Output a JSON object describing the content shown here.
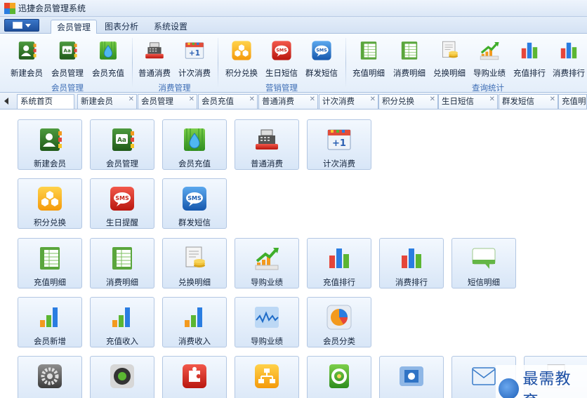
{
  "window": {
    "title": "迅捷会员管理系统"
  },
  "ribbon_tabs": [
    {
      "label": "会员管理",
      "active": true
    },
    {
      "label": "图表分析",
      "active": false
    },
    {
      "label": "系统设置",
      "active": false
    }
  ],
  "ribbon": {
    "buttons": [
      {
        "label": "新建会员",
        "icon": "member-card-icon"
      },
      {
        "label": "会员管理",
        "icon": "member-book-icon"
      },
      {
        "label": "会员充值",
        "icon": "water-drop-icon"
      },
      {
        "label": "普通消费",
        "icon": "cash-register-icon"
      },
      {
        "label": "计次消费",
        "icon": "plus-one-calendar-icon"
      },
      {
        "label": "积分兑换",
        "icon": "honeycomb-icon"
      },
      {
        "label": "生日短信",
        "icon": "sms-red-icon"
      },
      {
        "label": "群发短信",
        "icon": "sms-blue-icon"
      },
      {
        "label": "充值明细",
        "icon": "green-sheet-icon"
      },
      {
        "label": "消费明细",
        "icon": "green-sheet-icon"
      },
      {
        "label": "兑换明细",
        "icon": "coin-document-icon"
      },
      {
        "label": "导购业绩",
        "icon": "growth-arrow-chart-icon"
      },
      {
        "label": "充值排行",
        "icon": "bar-chart-icon"
      },
      {
        "label": "消费排行",
        "icon": "bar-chart-icon"
      }
    ],
    "groups": [
      {
        "label": "会员管理"
      },
      {
        "label": "消费管理"
      },
      {
        "label": "营销管理"
      },
      {
        "label": "查询统计"
      }
    ]
  },
  "doc_tabs": [
    {
      "label": "系统首页",
      "active": true,
      "closable": false
    },
    {
      "label": "新建会员",
      "closable": true
    },
    {
      "label": "会员管理",
      "closable": true
    },
    {
      "label": "会员充值",
      "closable": true
    },
    {
      "label": "普通消费",
      "closable": true
    },
    {
      "label": "计次消费",
      "closable": true
    },
    {
      "label": "积分兑换",
      "closable": true
    },
    {
      "label": "生日短信",
      "closable": true
    },
    {
      "label": "群发短信",
      "closable": true
    },
    {
      "label": "充值明",
      "closable": false
    }
  ],
  "home_tiles": {
    "row1": [
      {
        "label": "新建会员",
        "icon": "member-card-icon"
      },
      {
        "label": "会员管理",
        "icon": "member-book-icon"
      },
      {
        "label": "会员充值",
        "icon": "water-drop-icon"
      },
      {
        "label": "普通消费",
        "icon": "cash-register-icon"
      },
      {
        "label": "计次消费",
        "icon": "plus-one-calendar-icon"
      }
    ],
    "row2": [
      {
        "label": "积分兑换",
        "icon": "honeycomb-icon"
      },
      {
        "label": "生日提醒",
        "icon": "sms-red-icon"
      },
      {
        "label": "群发短信",
        "icon": "sms-blue-icon"
      }
    ],
    "row3": [
      {
        "label": "充值明细",
        "icon": "green-sheet-icon"
      },
      {
        "label": "消费明细",
        "icon": "green-sheet-icon"
      },
      {
        "label": "兑换明细",
        "icon": "coin-document-icon"
      },
      {
        "label": "导购业绩",
        "icon": "growth-arrow-chart-icon"
      },
      {
        "label": "充值排行",
        "icon": "bar-chart-icon"
      },
      {
        "label": "消费排行",
        "icon": "bar-chart-icon"
      },
      {
        "label": "短信明细",
        "icon": "message-bubble-icon"
      }
    ],
    "row4": [
      {
        "label": "会员新增",
        "icon": "rising-bars-icon"
      },
      {
        "label": "充值收入",
        "icon": "rising-bars-icon"
      },
      {
        "label": "消费收入",
        "icon": "rising-bars-icon"
      },
      {
        "label": "导购业绩",
        "icon": "wave-chart-icon"
      },
      {
        "label": "会员分类",
        "icon": "pie-chart-icon"
      }
    ],
    "row5": [
      {
        "label": "",
        "icon": "gear-icon"
      },
      {
        "label": "",
        "icon": "dial-icon"
      },
      {
        "label": "",
        "icon": "puzzle-icon"
      },
      {
        "label": "",
        "icon": "org-chart-icon"
      },
      {
        "label": "",
        "icon": "green-refresh-icon"
      },
      {
        "label": "",
        "icon": "database-icon"
      },
      {
        "label": "",
        "icon": "envelope-icon"
      },
      {
        "label": "",
        "icon": "document-icon"
      }
    ]
  },
  "watermark": {
    "text": "最需教育"
  }
}
